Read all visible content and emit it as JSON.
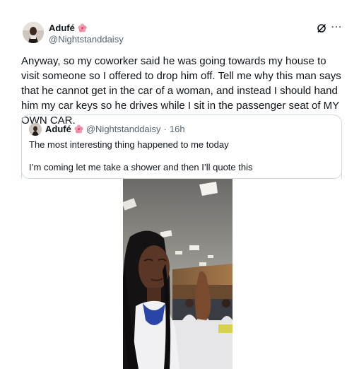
{
  "author": {
    "display_name": "Adufé",
    "handle": "@Nightstanddaisy",
    "name_emoji": "hibiscus-icon"
  },
  "actions": {
    "grok_icon": "grok-icon",
    "more_icon": "more-icon",
    "more_glyph": "⋯"
  },
  "tweet": {
    "text": "Anyway, so my coworker said he was going towards my house to visit someone so I offered to drop him off. Tell me why this man says that he cannot get in the car of a woman, and instead I should hand him my car keys so he drives while I sit in the passenger seat of MY OWN CAR."
  },
  "quote": {
    "display_name": "Adufé",
    "handle": "@Nightstanddaisy",
    "separator": "·",
    "time": "16h",
    "line1": "The most interesting thing happened to me today",
    "line2": "I’m coming let me take a shower and then I’ll quote this"
  },
  "colors": {
    "text": "#0f1419",
    "secondary": "#536471",
    "border": "#cfd9de",
    "flower": "#e88aa0"
  }
}
